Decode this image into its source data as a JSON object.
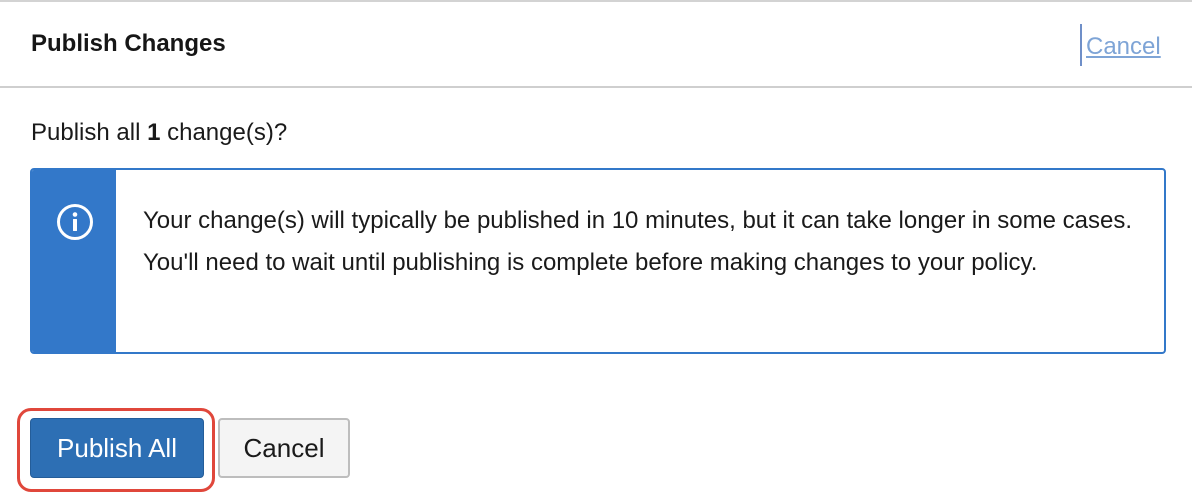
{
  "dialog": {
    "title": "Publish Changes",
    "header_cancel_label": "Cancel"
  },
  "question": {
    "prefix": "Publish all",
    "count": "1",
    "suffix": "change(s)?"
  },
  "info": {
    "icon": "info-circle-icon",
    "message": "Your change(s) will typically be published in 10 minutes, but it can take longer in some cases. You'll need to wait until publishing is complete before making changes to your policy."
  },
  "actions": {
    "publish_all_label": "Publish All",
    "cancel_label": "Cancel"
  },
  "colors": {
    "primary": "#2d6fb4",
    "info_accent": "#3378c9",
    "highlight": "#e0473b",
    "link": "#7ea4d6"
  }
}
